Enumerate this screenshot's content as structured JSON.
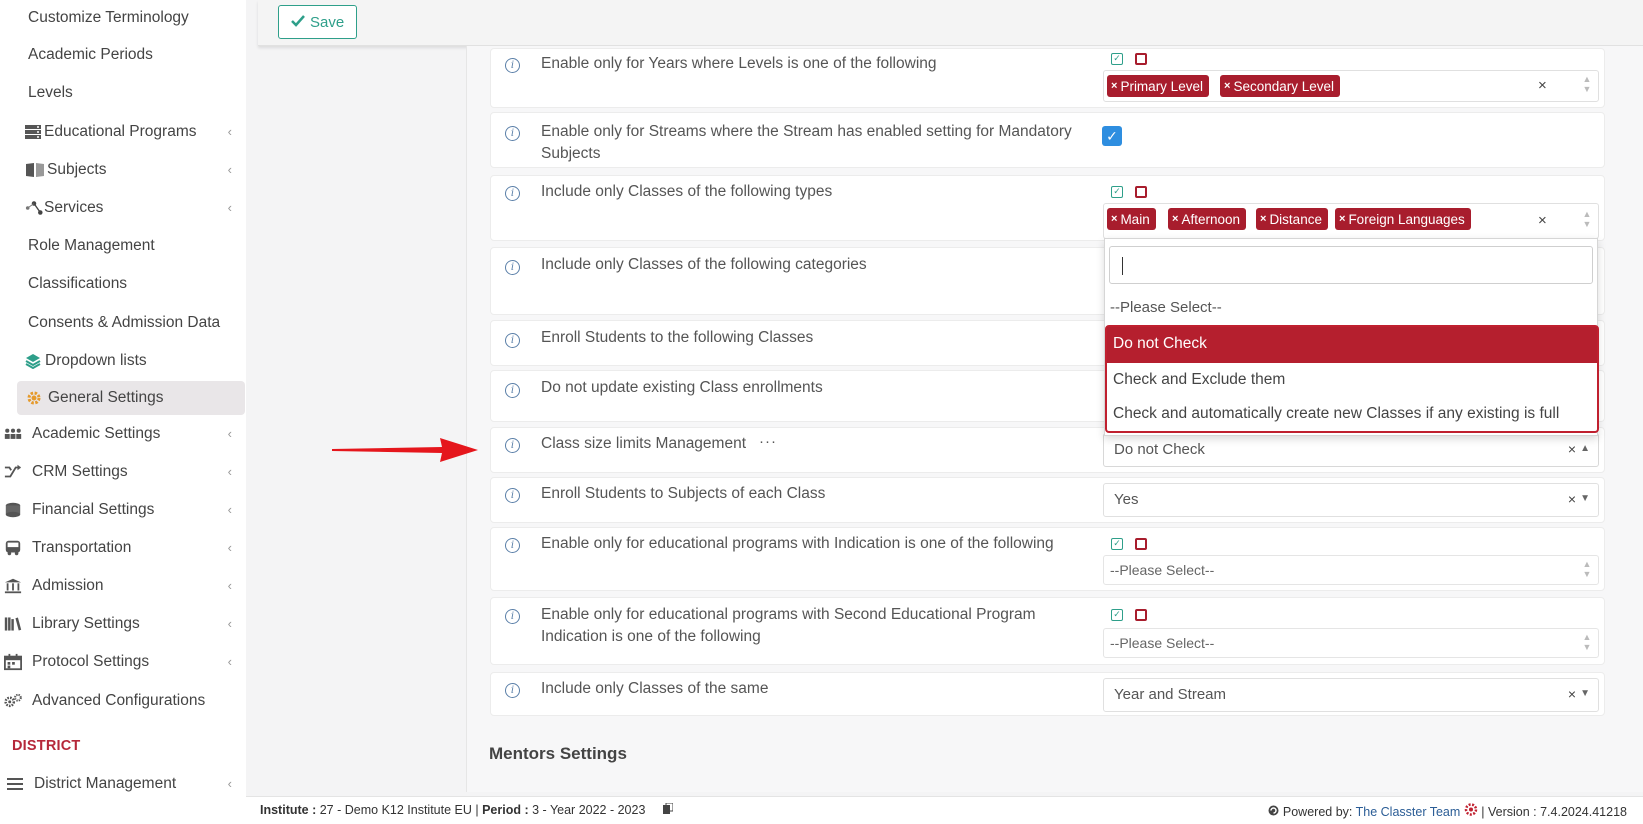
{
  "sidebar": {
    "items": [
      {
        "label": "Customize Terminology",
        "icon": "",
        "chevron": false
      },
      {
        "label": "Academic Periods",
        "icon": "",
        "chevron": false
      },
      {
        "label": "Levels",
        "icon": "",
        "chevron": false
      },
      {
        "label": "Educational Programs",
        "icon": "server-icon",
        "chevron": true
      },
      {
        "label": "Subjects",
        "icon": "book-icon",
        "chevron": true
      },
      {
        "label": "Services",
        "icon": "nodes-icon",
        "chevron": true
      },
      {
        "label": "Role Management",
        "icon": "",
        "chevron": false
      },
      {
        "label": "Classifications",
        "icon": "",
        "chevron": false
      },
      {
        "label": "Consents & Admission Data",
        "icon": "",
        "chevron": false
      },
      {
        "label": "Dropdown lists",
        "icon": "layers-icon",
        "chevron": false
      },
      {
        "label": "General Settings",
        "icon": "gear-icon",
        "chevron": false,
        "active": true
      },
      {
        "label": "Academic Settings",
        "icon": "people-icon",
        "chevron": true
      },
      {
        "label": "CRM Settings",
        "icon": "shuffle-icon",
        "chevron": true
      },
      {
        "label": "Financial Settings",
        "icon": "coins-icon",
        "chevron": true
      },
      {
        "label": "Transportation",
        "icon": "bus-icon",
        "chevron": true
      },
      {
        "label": "Admission",
        "icon": "bank-icon",
        "chevron": true
      },
      {
        "label": "Library Settings",
        "icon": "library-icon",
        "chevron": true
      },
      {
        "label": "Protocol Settings",
        "icon": "calendar-icon",
        "chevron": true
      },
      {
        "label": "Advanced Configurations",
        "icon": "gears-icon",
        "chevron": false
      }
    ],
    "district_heading": "DISTRICT",
    "district_item": "District Management"
  },
  "toolbar": {
    "save_label": "Save"
  },
  "settings": {
    "row1_label": "Enable only for Years where Levels is one of the following",
    "row1_tags": [
      "Primary Level",
      "Secondary Level"
    ],
    "row2_label": "Enable only for Streams where the Stream has enabled setting for Mandatory Subjects",
    "row3_label": "Include only Classes of the following types",
    "row3_tags": [
      "Main",
      "Afternoon",
      "Distance",
      "Foreign Languages"
    ],
    "row4_label": "Include only Classes of the following categories",
    "row5_label": "Enroll Students to the following Classes",
    "row6_label": "Do not update existing Class enrollments",
    "row7_label": "Class size limits Management",
    "row7_more": "···",
    "row7_value": "Do not Check",
    "row8_label": "Enroll Students to Subjects of each Class",
    "row8_value": "Yes",
    "row9_label": "Enable only for educational programs with Indication is one of the following",
    "row9_placeholder": "--Please Select--",
    "row10_label": "Enable only for educational programs with Second Educational Program Indication is one of the following",
    "row10_placeholder": "--Please Select--",
    "row11_label": "Include only Classes of the same",
    "row11_value": "Year and Stream"
  },
  "dropdown": {
    "placeholder": "--Please Select--",
    "options": [
      "Do not Check",
      "Check and Exclude them",
      "Check and automatically create new Classes if any existing is full"
    ],
    "selected": "Do not Check"
  },
  "section_title": "Mentors Settings",
  "footer": {
    "institute_label": "Institute :",
    "institute_value": "27 - Demo K12 Institute EU",
    "period_label": "Period :",
    "period_value": "3 - Year 2022 - 2023",
    "powered_by": "Powered by:",
    "team": "The Classter Team",
    "version": "| Version : 7.4.2024.41218"
  },
  "colors": {
    "accent_red": "#a81d2d",
    "save_teal": "#2e9f8a",
    "check_blue": "#2e8ee0"
  }
}
